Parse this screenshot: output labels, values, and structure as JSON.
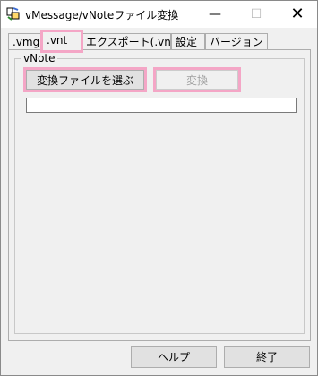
{
  "window": {
    "title": "vMessage/vNoteファイル変換",
    "minimize_glyph": "—",
    "maximize_glyph": "☐",
    "close_glyph": "✕"
  },
  "tabs": [
    {
      "label": ".vmg",
      "active": false
    },
    {
      "label": ".vnt",
      "active": true
    },
    {
      "label": "エクスポート(.vnt)",
      "active": false
    },
    {
      "label": "設定",
      "active": false
    },
    {
      "label": "バージョン",
      "active": false
    }
  ],
  "panel": {
    "group_label": "vNote",
    "choose_file_label": "変換ファイルを選ぶ",
    "convert_label": "変換",
    "convert_enabled": false,
    "file_path_value": ""
  },
  "footer": {
    "help_label": "ヘルプ",
    "exit_label": "終了"
  },
  "colors": {
    "highlight": "#f4a6c6",
    "window_bg": "#f0f0f0"
  }
}
